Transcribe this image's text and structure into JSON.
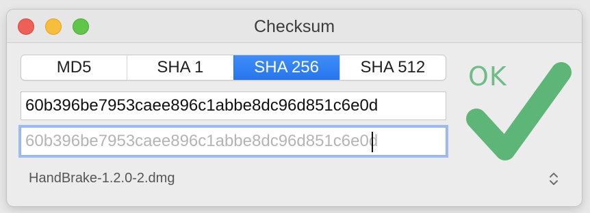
{
  "window": {
    "title": "Checksum"
  },
  "algorithms": {
    "tabs": [
      {
        "label": "MD5",
        "selected": false
      },
      {
        "label": "SHA 1",
        "selected": false
      },
      {
        "label": "SHA 256",
        "selected": true
      },
      {
        "label": "SHA 512",
        "selected": false
      }
    ]
  },
  "computed_hash": {
    "value": "60b396be7953caee896c1abbe8dc96d851c6e0d"
  },
  "compare_input": {
    "value": "60b396be7953caee896c1abbe8dc96d851c6e0d"
  },
  "file": {
    "name": "HandBrake-1.2.0-2.dmg"
  },
  "status": {
    "text": "OK",
    "icon": "checkmark-icon"
  },
  "colors": {
    "accent": "#2675ef",
    "success": "#5db577",
    "close": "#ee5f58",
    "minimize": "#f6be3a",
    "zoom": "#5fc64a"
  }
}
